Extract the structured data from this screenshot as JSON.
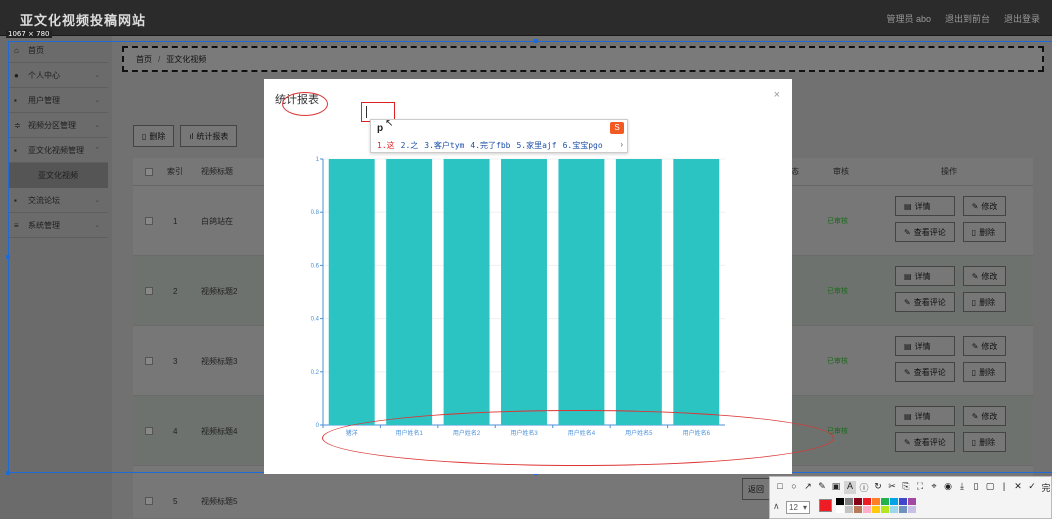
{
  "site": {
    "title": "亚文化视频投稿网站",
    "user": "管理员 abo",
    "frontend": "退出到前台",
    "logout": "退出登录"
  },
  "size_tag": "1067 × 780",
  "sidebar": {
    "items": [
      {
        "label": "首页",
        "icon": "home-icon",
        "glyph": "⌂"
      },
      {
        "label": "个人中心",
        "icon": "user-icon",
        "glyph": "●"
      },
      {
        "label": "用户管理",
        "icon": "users-icon",
        "glyph": "▪"
      },
      {
        "label": "视频分区管理",
        "icon": "category-icon",
        "glyph": "≑"
      },
      {
        "label": "亚文化视频管理",
        "icon": "video-icon",
        "glyph": "▪"
      }
    ],
    "sub_item": "亚文化视频",
    "items2": [
      {
        "label": "交流论坛",
        "icon": "forum-icon",
        "glyph": "▪"
      },
      {
        "label": "系统管理",
        "icon": "settings-icon",
        "glyph": "≡"
      }
    ]
  },
  "breadcrumb": {
    "home": "首页",
    "sep": "/",
    "current": "亚文化视频"
  },
  "buttons": {
    "delete": "删除",
    "report": "统计报表"
  },
  "table": {
    "headers": {
      "index": "索引",
      "title": "视频标题",
      "col_partial": "态",
      "review": "审核",
      "ops": "操作"
    },
    "rows": [
      {
        "index": "1",
        "title": "白鸽站在",
        "status": "已审核"
      },
      {
        "index": "2",
        "title": "视频标题2",
        "status": "已审核"
      },
      {
        "index": "3",
        "title": "视频标题3",
        "status": "已审核"
      },
      {
        "index": "4",
        "title": "视频标题4",
        "status": "已审核"
      },
      {
        "index": "5",
        "title": "视频标题5",
        "status": ""
      }
    ],
    "ops": {
      "detail": "详情",
      "edit": "修改",
      "comments": "查看评论",
      "delete": "删除"
    }
  },
  "modal": {
    "title": "统计报表",
    "close": "×",
    "peek_button": "返回"
  },
  "ime": {
    "pinyin": "p",
    "candidates": [
      "1.这",
      "2.之",
      "3.客户tym",
      "4.完了fbb",
      "5.家里ajf",
      "6.宝宝pgo"
    ],
    "more": "›",
    "logo": "S"
  },
  "chart_data": {
    "type": "bar",
    "categories": [
      "猪洋",
      "用户姓名1",
      "用户姓名2",
      "用户姓名3",
      "用户姓名4",
      "用户姓名5",
      "用户姓名6"
    ],
    "values": [
      1,
      1,
      1,
      1,
      1,
      1,
      1
    ],
    "ylim": [
      0,
      1
    ],
    "yticks": [
      0,
      0.2,
      0.4,
      0.6,
      0.8,
      1
    ],
    "bar_color": "#2cc3c3",
    "grid": true
  },
  "toolbar": {
    "tools": [
      "□",
      "○",
      "↗",
      "✎",
      "▣",
      "A",
      "ⓘ",
      "↻",
      "✂",
      "⎘",
      "⛶",
      "⌖",
      "◉",
      "⤓",
      "▯",
      "▢",
      "|",
      "✕",
      "✓",
      "完"
    ],
    "size": "12",
    "current_color": "#ee1c24",
    "palette": [
      "#000000",
      "#7f7f7f",
      "#880015",
      "#ed1c24",
      "#ff7f27",
      "#22b14c",
      "#00a2e8",
      "#3f48cc",
      "#a349a4",
      "#ffffff",
      "#c3c3c3",
      "#b97a57",
      "#ffaec9",
      "#ffc90e",
      "#b5e61d",
      "#99d9ea",
      "#7092be",
      "#c8bfe7"
    ]
  }
}
